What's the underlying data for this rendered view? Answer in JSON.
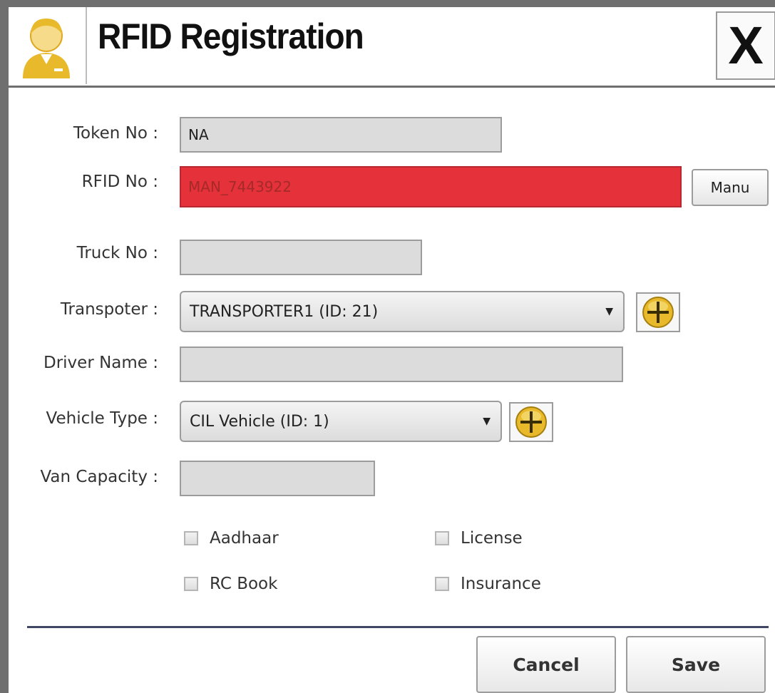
{
  "window": {
    "title": "RFID Registration",
    "close_label": "X"
  },
  "form": {
    "token": {
      "label": "Token No :",
      "value": "NA"
    },
    "rfid": {
      "label": "RFID No :",
      "value": "MAN_7443922",
      "button": "Manu",
      "background": "#e5313a"
    },
    "truck": {
      "label": "Truck No :",
      "value": ""
    },
    "transporter": {
      "label": "Transpoter :",
      "selected": "TRANSPORTER1 (ID: 21)"
    },
    "driver": {
      "label": "Driver Name :",
      "value": ""
    },
    "vehicle_type": {
      "label": "Vehicle Type :",
      "selected": "CIL Vehicle (ID: 1)"
    },
    "van_capacity": {
      "label": "Van Capacity  :",
      "value": ""
    }
  },
  "documents": [
    {
      "label": "Aadhaar",
      "checked": false
    },
    {
      "label": "License",
      "checked": false
    },
    {
      "label": "RC Book",
      "checked": false
    },
    {
      "label": "Insurance",
      "checked": false
    }
  ],
  "actions": {
    "cancel": "Cancel",
    "save": "Save"
  },
  "icons": {
    "avatar": "user-avatar-icon",
    "add": "add-circle-icon",
    "dropdown": "chevron-down-icon"
  },
  "colors": {
    "accent_gold": "#e8b92b",
    "error_red": "#e5313a",
    "divider": "#3f4666"
  }
}
